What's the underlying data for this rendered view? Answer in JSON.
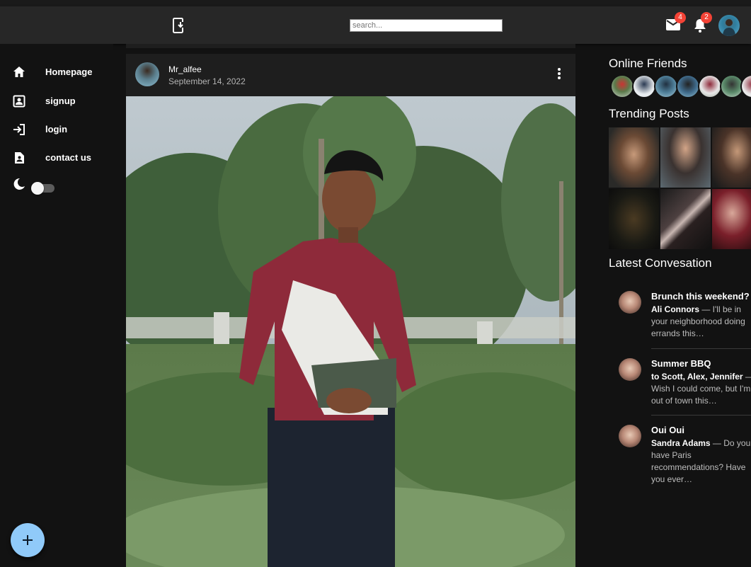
{
  "header": {
    "search_placeholder": "search...",
    "mail_count": "4",
    "notification_count": "2"
  },
  "sidebar": {
    "items": [
      {
        "label": "Homepage",
        "icon": "home-icon"
      },
      {
        "label": "signup",
        "icon": "account-box-icon"
      },
      {
        "label": "login",
        "icon": "login-icon"
      },
      {
        "label": "contact us",
        "icon": "contact-page-icon"
      }
    ],
    "theme_toggle_icon": "moon-icon"
  },
  "post": {
    "username": "Mr_alfee",
    "date": "September 14, 2022"
  },
  "right": {
    "online_friends_title": "Online Friends",
    "trending_title": "Trending Posts",
    "latest_title": "Latest Convesation",
    "conversations": [
      {
        "title": "Brunch this weekend?",
        "who": "Ali Connors",
        "text": " — I'll be in your neighborhood doing errands this…"
      },
      {
        "title": "Summer BBQ",
        "who": "to Scott, Alex, Jennifer",
        "text": " — Wish I could come, but I'm out of town this…"
      },
      {
        "title": "Oui Oui",
        "who": "Sandra Adams",
        "text": " — Do you have Paris recommendations? Have you ever…"
      }
    ]
  },
  "colors": {
    "appbar": "#272727",
    "background": "#121212",
    "card": "#1e1e1e",
    "fab": "#90caf9",
    "badge": "#f44336"
  }
}
